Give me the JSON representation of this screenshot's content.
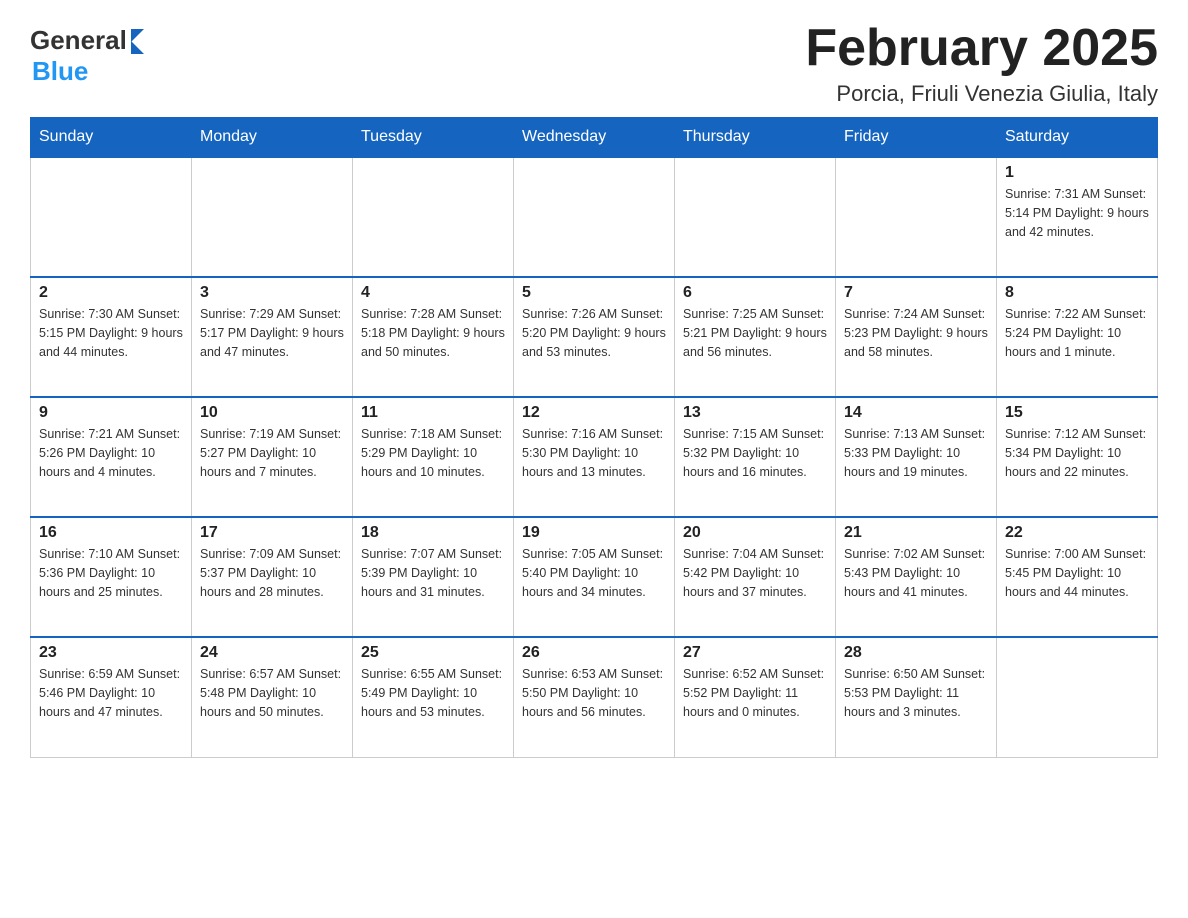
{
  "header": {
    "logo_general": "General",
    "logo_blue": "Blue",
    "month_title": "February 2025",
    "location": "Porcia, Friuli Venezia Giulia, Italy"
  },
  "days_of_week": [
    "Sunday",
    "Monday",
    "Tuesday",
    "Wednesday",
    "Thursday",
    "Friday",
    "Saturday"
  ],
  "weeks": [
    [
      {
        "day": "",
        "info": ""
      },
      {
        "day": "",
        "info": ""
      },
      {
        "day": "",
        "info": ""
      },
      {
        "day": "",
        "info": ""
      },
      {
        "day": "",
        "info": ""
      },
      {
        "day": "",
        "info": ""
      },
      {
        "day": "1",
        "info": "Sunrise: 7:31 AM\nSunset: 5:14 PM\nDaylight: 9 hours and 42 minutes."
      }
    ],
    [
      {
        "day": "2",
        "info": "Sunrise: 7:30 AM\nSunset: 5:15 PM\nDaylight: 9 hours and 44 minutes."
      },
      {
        "day": "3",
        "info": "Sunrise: 7:29 AM\nSunset: 5:17 PM\nDaylight: 9 hours and 47 minutes."
      },
      {
        "day": "4",
        "info": "Sunrise: 7:28 AM\nSunset: 5:18 PM\nDaylight: 9 hours and 50 minutes."
      },
      {
        "day": "5",
        "info": "Sunrise: 7:26 AM\nSunset: 5:20 PM\nDaylight: 9 hours and 53 minutes."
      },
      {
        "day": "6",
        "info": "Sunrise: 7:25 AM\nSunset: 5:21 PM\nDaylight: 9 hours and 56 minutes."
      },
      {
        "day": "7",
        "info": "Sunrise: 7:24 AM\nSunset: 5:23 PM\nDaylight: 9 hours and 58 minutes."
      },
      {
        "day": "8",
        "info": "Sunrise: 7:22 AM\nSunset: 5:24 PM\nDaylight: 10 hours and 1 minute."
      }
    ],
    [
      {
        "day": "9",
        "info": "Sunrise: 7:21 AM\nSunset: 5:26 PM\nDaylight: 10 hours and 4 minutes."
      },
      {
        "day": "10",
        "info": "Sunrise: 7:19 AM\nSunset: 5:27 PM\nDaylight: 10 hours and 7 minutes."
      },
      {
        "day": "11",
        "info": "Sunrise: 7:18 AM\nSunset: 5:29 PM\nDaylight: 10 hours and 10 minutes."
      },
      {
        "day": "12",
        "info": "Sunrise: 7:16 AM\nSunset: 5:30 PM\nDaylight: 10 hours and 13 minutes."
      },
      {
        "day": "13",
        "info": "Sunrise: 7:15 AM\nSunset: 5:32 PM\nDaylight: 10 hours and 16 minutes."
      },
      {
        "day": "14",
        "info": "Sunrise: 7:13 AM\nSunset: 5:33 PM\nDaylight: 10 hours and 19 minutes."
      },
      {
        "day": "15",
        "info": "Sunrise: 7:12 AM\nSunset: 5:34 PM\nDaylight: 10 hours and 22 minutes."
      }
    ],
    [
      {
        "day": "16",
        "info": "Sunrise: 7:10 AM\nSunset: 5:36 PM\nDaylight: 10 hours and 25 minutes."
      },
      {
        "day": "17",
        "info": "Sunrise: 7:09 AM\nSunset: 5:37 PM\nDaylight: 10 hours and 28 minutes."
      },
      {
        "day": "18",
        "info": "Sunrise: 7:07 AM\nSunset: 5:39 PM\nDaylight: 10 hours and 31 minutes."
      },
      {
        "day": "19",
        "info": "Sunrise: 7:05 AM\nSunset: 5:40 PM\nDaylight: 10 hours and 34 minutes."
      },
      {
        "day": "20",
        "info": "Sunrise: 7:04 AM\nSunset: 5:42 PM\nDaylight: 10 hours and 37 minutes."
      },
      {
        "day": "21",
        "info": "Sunrise: 7:02 AM\nSunset: 5:43 PM\nDaylight: 10 hours and 41 minutes."
      },
      {
        "day": "22",
        "info": "Sunrise: 7:00 AM\nSunset: 5:45 PM\nDaylight: 10 hours and 44 minutes."
      }
    ],
    [
      {
        "day": "23",
        "info": "Sunrise: 6:59 AM\nSunset: 5:46 PM\nDaylight: 10 hours and 47 minutes."
      },
      {
        "day": "24",
        "info": "Sunrise: 6:57 AM\nSunset: 5:48 PM\nDaylight: 10 hours and 50 minutes."
      },
      {
        "day": "25",
        "info": "Sunrise: 6:55 AM\nSunset: 5:49 PM\nDaylight: 10 hours and 53 minutes."
      },
      {
        "day": "26",
        "info": "Sunrise: 6:53 AM\nSunset: 5:50 PM\nDaylight: 10 hours and 56 minutes."
      },
      {
        "day": "27",
        "info": "Sunrise: 6:52 AM\nSunset: 5:52 PM\nDaylight: 11 hours and 0 minutes."
      },
      {
        "day": "28",
        "info": "Sunrise: 6:50 AM\nSunset: 5:53 PM\nDaylight: 11 hours and 3 minutes."
      },
      {
        "day": "",
        "info": ""
      }
    ]
  ]
}
